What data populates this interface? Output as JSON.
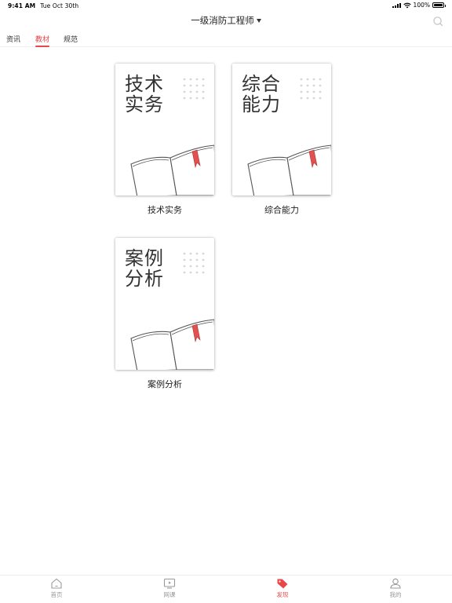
{
  "status_bar": {
    "time": "9:41 AM",
    "date": "Tue Oct 30th",
    "battery": "100%"
  },
  "header": {
    "title": "一级消防工程师",
    "search_icon": "search-icon"
  },
  "tabs": [
    {
      "label": "资讯"
    },
    {
      "label": "教材"
    },
    {
      "label": "规范"
    }
  ],
  "active_tab": "教材",
  "books": [
    {
      "cover_line1": "技术",
      "cover_line2": "实务",
      "label": "技术实务"
    },
    {
      "cover_line1": "综合",
      "cover_line2": "能力",
      "label": "综合能力"
    },
    {
      "cover_line1": "案例",
      "cover_line2": "分析",
      "label": "案例分析"
    }
  ],
  "tabbar": [
    {
      "label": "首页",
      "icon": "home-icon"
    },
    {
      "label": "网课",
      "icon": "tv-icon"
    },
    {
      "label": "发现",
      "icon": "tag-icon"
    },
    {
      "label": "我的",
      "icon": "user-icon"
    }
  ],
  "colors": {
    "accent": "#e9474a",
    "text": "#222222",
    "muted": "#999999"
  }
}
